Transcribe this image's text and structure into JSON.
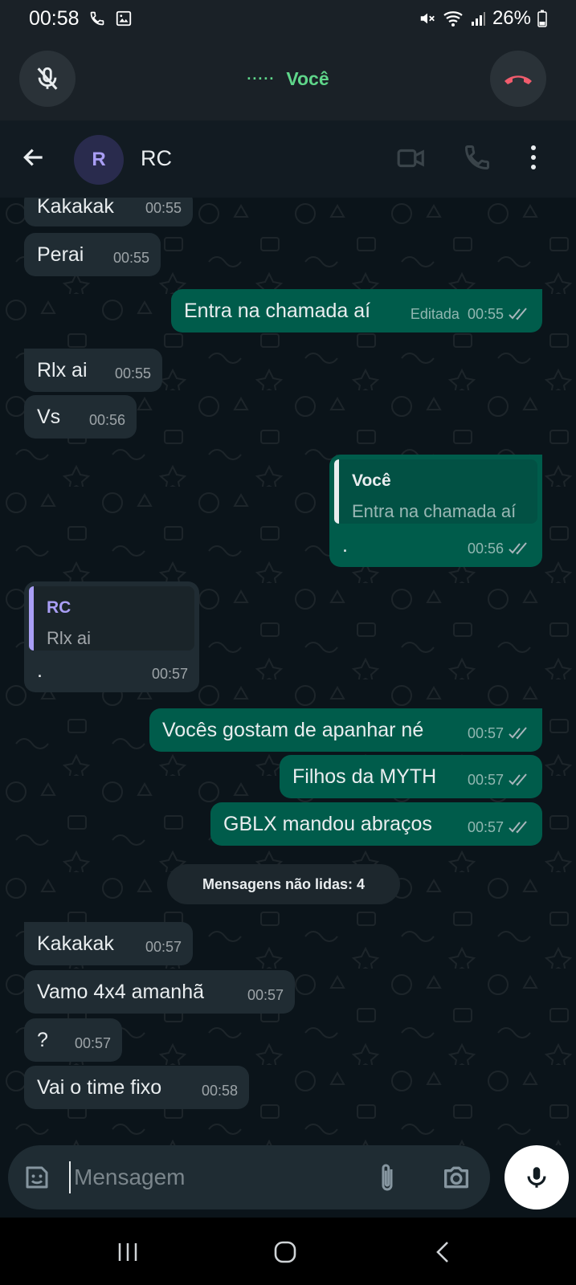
{
  "status_bar": {
    "time": "00:58",
    "battery": "26%"
  },
  "call_bar": {
    "label": "Você",
    "dots": "·····"
  },
  "header": {
    "avatar_letter": "R",
    "contact_name": "RC"
  },
  "messages": [
    {
      "text": "Kakakak",
      "time": "00:55"
    },
    {
      "text": "Perai",
      "time": "00:55"
    },
    {
      "text": "Entra na chamada aí",
      "edited": "Editada",
      "time": "00:55"
    },
    {
      "text": "Rlx ai",
      "time": "00:55"
    },
    {
      "text": "Vs",
      "time": "00:56"
    },
    {
      "quote_name": "Você",
      "quote_text": "Entra na chamada aí",
      "text": ".",
      "time": "00:56"
    },
    {
      "quote_name": "RC",
      "quote_text": "Rlx ai",
      "text": ".",
      "time": "00:57"
    },
    {
      "text": "Vocês gostam de apanhar né",
      "time": "00:57"
    },
    {
      "text": "Filhos da MYTH",
      "time": "00:57"
    },
    {
      "text": "GBLX mandou abraços",
      "time": "00:57"
    },
    {
      "text": "Kakakak",
      "time": "00:57"
    },
    {
      "text": "Vamo 4x4 amanhã",
      "time": "00:57"
    },
    {
      "text": "?",
      "time": "00:57"
    },
    {
      "text": "Vai o time fixo",
      "time": "00:58"
    }
  ],
  "unread_label": "Mensagens não lidas: 4",
  "composer": {
    "placeholder": "Mensagem"
  },
  "colors": {
    "outgoing": "#005c4b",
    "incoming": "#202c33",
    "call_green": "#5fd68a",
    "end_call_red": "#f15c6d",
    "quote_purple": "#a99ef5"
  },
  "icons": [
    "mic-off-icon",
    "end-call-icon",
    "back-arrow-icon",
    "video-call-icon",
    "voice-call-icon",
    "more-options-icon",
    "sticker-icon",
    "attach-icon",
    "camera-icon",
    "mic-icon",
    "recents-icon",
    "home-icon",
    "nav-back-icon"
  ]
}
